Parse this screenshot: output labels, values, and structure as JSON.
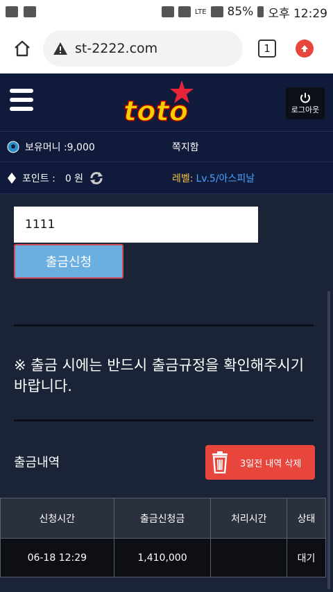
{
  "status_bar": {
    "battery": "85%",
    "time": "오후 12:29",
    "network": "LTE"
  },
  "browser": {
    "url": "st-2222.com",
    "tab_count": "1"
  },
  "header": {
    "logo_text": "toto",
    "logout_label": "로그아웃"
  },
  "user_info": {
    "money_label": "보유머니 :9,000",
    "messages_label": "쪽지함",
    "points_label": "포인트 :",
    "points_value": "0 원",
    "level_label": "레벨:",
    "level_value": "Lv.5/아스피날"
  },
  "withdraw_form": {
    "amount_value": "1111",
    "submit_label": "출금신청"
  },
  "notice": "※ 출금 시에는 반드시 출금규정을 확인해주시기 바랍니다.",
  "history": {
    "title": "출금내역",
    "delete_label": "3일전 내역 삭제",
    "columns": [
      "신청시간",
      "출금신청금",
      "처리시간",
      "상태"
    ],
    "rows": [
      {
        "request_time": "06-18 12:29",
        "amount": "1,410,000",
        "processed_time": "",
        "status": "대기"
      }
    ]
  },
  "colors": {
    "accent_blue": "#6aafe0",
    "delete_red": "#e8453c",
    "level_yellow": "#f6c343",
    "level_blue": "#4aa3ff"
  }
}
